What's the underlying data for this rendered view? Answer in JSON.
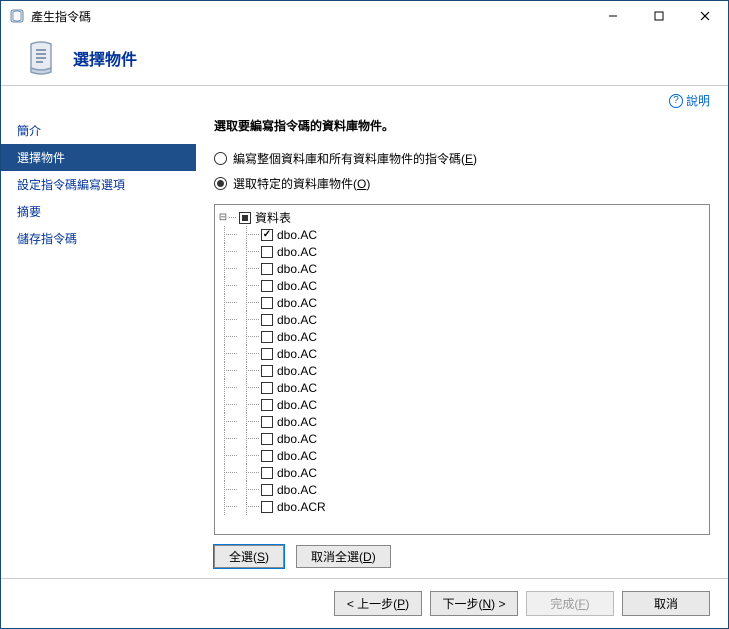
{
  "window": {
    "title": "產生指令碼"
  },
  "header": {
    "title": "選擇物件"
  },
  "help": {
    "label": "說明"
  },
  "sidebar": {
    "items": [
      {
        "label": "簡介",
        "active": false
      },
      {
        "label": "選擇物件",
        "active": true
      },
      {
        "label": "設定指令碼編寫選項",
        "active": false
      },
      {
        "label": "摘要",
        "active": false
      },
      {
        "label": "儲存指令碼",
        "active": false
      }
    ]
  },
  "content": {
    "instruction": "選取要編寫指令碼的資料庫物件。",
    "radio_all": {
      "label": "編寫整個資料庫和所有資料庫物件的指令碼(",
      "accel": "E",
      "tail": ")",
      "checked": false
    },
    "radio_specific": {
      "label": "選取特定的資料庫物件(",
      "accel": "O",
      "tail": ")",
      "checked": true
    },
    "tree": {
      "root": {
        "label": "資料表",
        "expanded": true,
        "state": "tri"
      },
      "items": [
        {
          "label": "dbo.AC",
          "checked": true
        },
        {
          "label": "dbo.AC",
          "checked": false
        },
        {
          "label": "dbo.AC",
          "checked": false
        },
        {
          "label": "dbo.AC",
          "checked": false
        },
        {
          "label": "dbo.AC",
          "checked": false
        },
        {
          "label": "dbo.AC",
          "checked": false
        },
        {
          "label": "dbo.AC",
          "checked": false
        },
        {
          "label": "dbo.AC",
          "checked": false
        },
        {
          "label": "dbo.AC",
          "checked": false
        },
        {
          "label": "dbo.AC",
          "checked": false
        },
        {
          "label": "dbo.AC",
          "checked": false
        },
        {
          "label": "dbo.AC",
          "checked": false
        },
        {
          "label": "dbo.AC",
          "checked": false
        },
        {
          "label": "dbo.AC",
          "checked": false
        },
        {
          "label": "dbo.AC",
          "checked": false
        },
        {
          "label": "dbo.AC",
          "checked": false
        },
        {
          "label": "dbo.ACR",
          "checked": false
        }
      ]
    },
    "select_all": {
      "label": "全選(",
      "accel": "S",
      "tail": ")"
    },
    "deselect_all": {
      "label": "取消全選(",
      "accel": "D",
      "tail": ")"
    }
  },
  "footer": {
    "back": {
      "pre": "< 上一步(",
      "accel": "P",
      "tail": ")"
    },
    "next": {
      "pre": "下一步(",
      "accel": "N",
      "tail": ") >"
    },
    "finish": {
      "pre": "完成(",
      "accel": "F",
      "tail": ")",
      "disabled": true
    },
    "cancel": {
      "label": "取消"
    }
  }
}
